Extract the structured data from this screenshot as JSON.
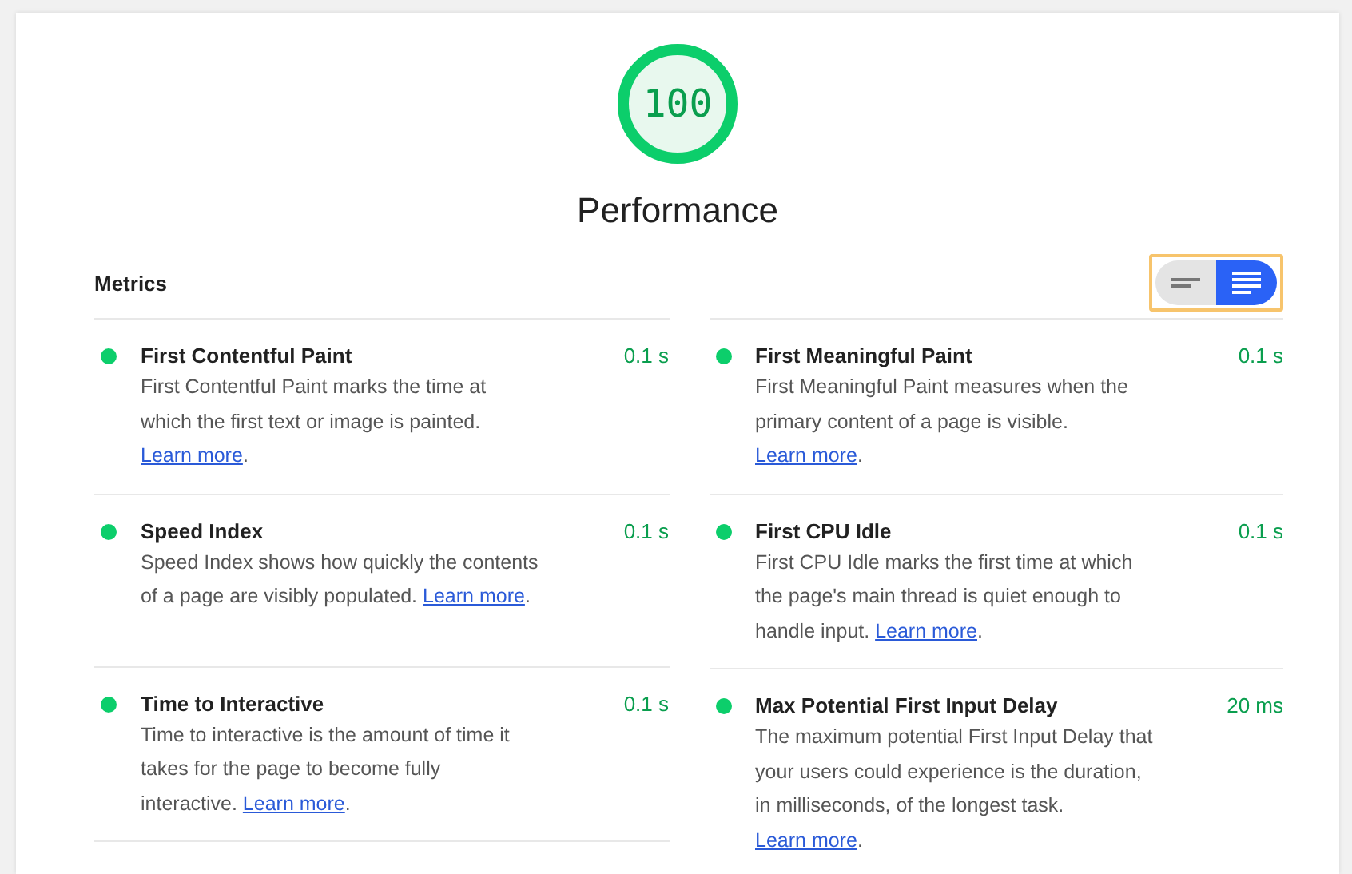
{
  "score": {
    "value": "100",
    "level": 1,
    "title": "Performance"
  },
  "metrics_heading": "Metrics",
  "view_toggle": {
    "focused": true,
    "options": [
      {
        "kind": "compact",
        "selected": false
      },
      {
        "kind": "expanded",
        "selected": true
      }
    ]
  },
  "columns": [
    [
      {
        "title": "First Contentful Paint",
        "value": "0.1 s",
        "description": "First Contentful Paint marks the time at which the first text or image is painted.",
        "link": "Learn more",
        "link_suffix": "."
      },
      {
        "title": "Speed Index",
        "value": "0.1 s",
        "description": "Speed Index shows how quickly the contents of a page are visibly populated.",
        "link": "Learn more",
        "link_suffix": "."
      },
      {
        "title": "Time to Interactive",
        "value": "0.1 s",
        "description": "Time to interactive is the amount of time it takes for the page to become fully interactive.",
        "link": "Learn more",
        "link_suffix": "."
      }
    ],
    [
      {
        "title": "First Meaningful Paint",
        "value": "0.1 s",
        "description": "First Meaningful Paint measures when the primary content of a page is visible.",
        "link": "Learn more",
        "link_suffix": "."
      },
      {
        "title": "First CPU Idle",
        "value": "0.1 s",
        "description": "First CPU Idle marks the first time at which the page's main thread is quiet enough to handle input.",
        "link": "Learn more",
        "link_suffix": "."
      },
      {
        "title": "Max Potential First Input Delay",
        "value": "20 ms",
        "description": "The maximum potential First Input Delay that your users could experience is the duration, in milliseconds, of the longest task.",
        "link": "Learn more",
        "link_suffix": "."
      }
    ]
  ]
}
